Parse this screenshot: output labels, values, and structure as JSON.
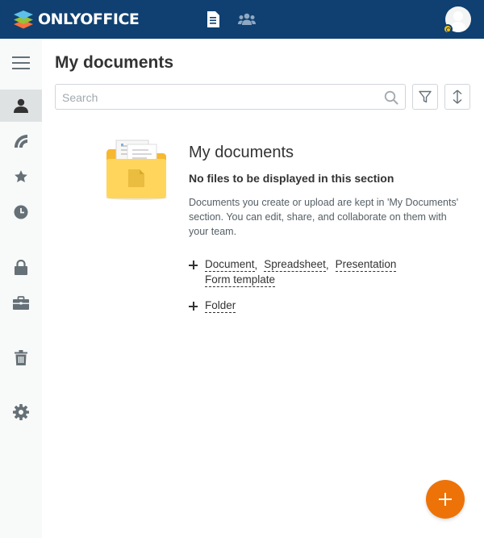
{
  "header": {
    "brand": "ONLYOFFICE",
    "icons": [
      "documents-icon",
      "people-icon"
    ],
    "bg_color": "#0f4071"
  },
  "sidebar": {
    "items": [
      {
        "name": "menu-icon"
      },
      {
        "name": "user-icon",
        "active": true
      },
      {
        "name": "feed-icon"
      },
      {
        "name": "star-icon"
      },
      {
        "name": "clock-icon"
      },
      {
        "name": "lock-icon"
      },
      {
        "name": "briefcase-icon"
      },
      {
        "name": "trash-icon"
      },
      {
        "name": "gear-icon"
      }
    ]
  },
  "main": {
    "title": "My documents",
    "search": {
      "placeholder": "Search",
      "value": ""
    },
    "empty": {
      "title": "My documents",
      "subtitle": "No files to be displayed in this section",
      "description": "Documents you create or upload are kept in 'My Documents' section. You can edit, share, and collaborate on them with your team.",
      "create_links": [
        "Document",
        "Spreadsheet",
        "Presentation",
        "Form template"
      ],
      "folder_link": "Folder"
    }
  },
  "colors": {
    "accent": "#ed7309",
    "sidebar_active": "#dfe2e3"
  }
}
